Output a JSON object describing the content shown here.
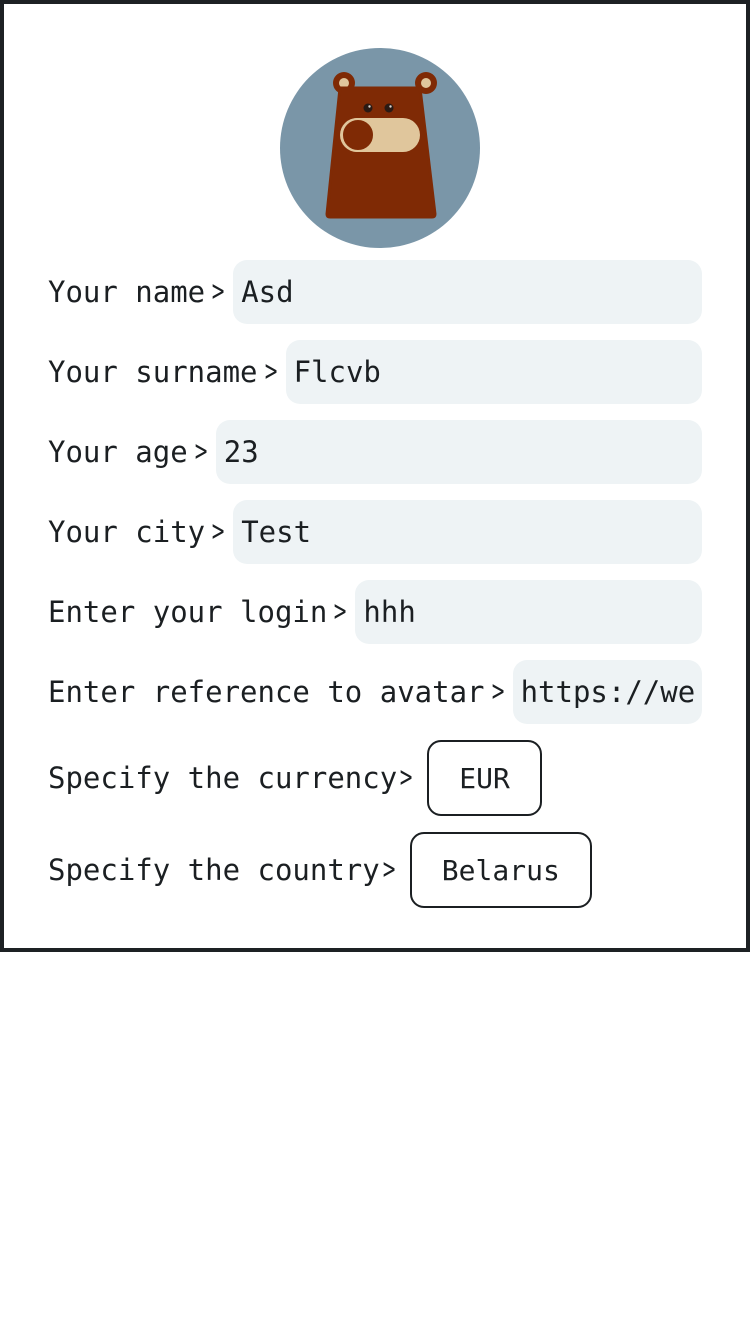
{
  "avatar": {
    "icon": "bear-avatar-icon",
    "background_color": "#7a96a8",
    "bear_color": "#7f2a05",
    "muzzle_color": "#e0c69c"
  },
  "fields": {
    "name": {
      "label": "Your name",
      "value": "Asd"
    },
    "surname": {
      "label": "Your surname",
      "value": "Flcvb"
    },
    "age": {
      "label": "Your age",
      "value": "23"
    },
    "city": {
      "label": "Your city",
      "value": "Test"
    },
    "login": {
      "label": "Enter your login",
      "value": "hhh"
    },
    "avatar_ref": {
      "label": "Enter reference to avatar",
      "value": "https://wel"
    }
  },
  "selectors": {
    "currency": {
      "label": "Specify the currency",
      "value": "EUR"
    },
    "country": {
      "label": "Specify the country",
      "value": "Belarus"
    }
  },
  "chevron": ">",
  "colors": {
    "input_background": "#eef3f5",
    "frame_border": "#1d2124",
    "text": "#1b1f22"
  }
}
